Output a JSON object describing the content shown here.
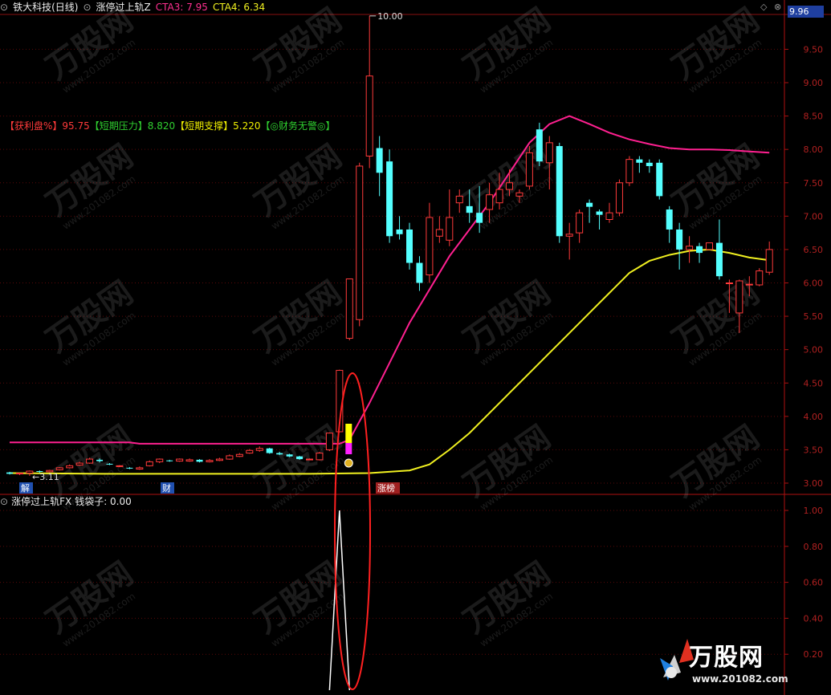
{
  "header": {
    "collapse_icon": "circle-icon",
    "title": "铁大科技(日线)",
    "indicator": "涨停过上轨Z",
    "cta3_label": "CTA3: 7.95",
    "cta4_label": "CTA4: 6.34",
    "current_price": "9.96"
  },
  "info_row": [
    {
      "text": "【获利盘%】",
      "color": "#ff3a3a"
    },
    {
      "text": "95.75",
      "color": "#ff3a3a"
    },
    {
      "text": "【短期压力】",
      "color": "#30d030"
    },
    {
      "text": "8.820",
      "color": "#30d030"
    },
    {
      "text": "【短期支撑】",
      "color": "#f0f000"
    },
    {
      "text": "5.220",
      "color": "#f0f000"
    },
    {
      "text": "【◎财务无警◎】",
      "color": "#30d030"
    }
  ],
  "markers": {
    "min_label": "←3.11",
    "max_label": "10.00",
    "bottom_tags": [
      "解",
      "财",
      "涨榜"
    ]
  },
  "indicator_panel": {
    "title": "涨停过上轨FX",
    "value_label": "钱袋子: 0.00"
  },
  "logo": {
    "text": "万股网",
    "url": "www.201082.com"
  },
  "chart_data": [
    {
      "type": "candlestick",
      "name": "price",
      "ylim": [
        2.95,
        10.15
      ],
      "yticks": [
        "3.00",
        "3.50",
        "4.00",
        "4.50",
        "5.00",
        "5.50",
        "6.00",
        "6.50",
        "7.00",
        "7.50",
        "8.00",
        "8.50",
        "9.00",
        "9.50"
      ],
      "candles": [
        {
          "o": 3.16,
          "c": 3.14,
          "h": 3.17,
          "l": 3.13
        },
        {
          "o": 3.14,
          "c": 3.15,
          "h": 3.16,
          "l": 3.12
        },
        {
          "o": 3.15,
          "c": 3.18,
          "h": 3.19,
          "l": 3.11
        },
        {
          "o": 3.18,
          "c": 3.17,
          "h": 3.19,
          "l": 3.15
        },
        {
          "o": 3.17,
          "c": 3.19,
          "h": 3.2,
          "l": 3.16
        },
        {
          "o": 3.2,
          "c": 3.23,
          "h": 3.24,
          "l": 3.19
        },
        {
          "o": 3.23,
          "c": 3.26,
          "h": 3.28,
          "l": 3.22
        },
        {
          "o": 3.27,
          "c": 3.3,
          "h": 3.32,
          "l": 3.26
        },
        {
          "o": 3.3,
          "c": 3.36,
          "h": 3.38,
          "l": 3.29
        },
        {
          "o": 3.35,
          "c": 3.33,
          "h": 3.37,
          "l": 3.31
        },
        {
          "o": 3.29,
          "c": 3.28,
          "h": 3.3,
          "l": 3.27
        },
        {
          "o": 3.25,
          "c": 3.26,
          "h": 3.27,
          "l": 3.24
        },
        {
          "o": 3.23,
          "c": 3.22,
          "h": 3.24,
          "l": 3.21
        },
        {
          "o": 3.21,
          "c": 3.23,
          "h": 3.25,
          "l": 3.2
        },
        {
          "o": 3.26,
          "c": 3.32,
          "h": 3.34,
          "l": 3.25
        },
        {
          "o": 3.32,
          "c": 3.36,
          "h": 3.37,
          "l": 3.3
        },
        {
          "o": 3.34,
          "c": 3.33,
          "h": 3.35,
          "l": 3.32
        },
        {
          "o": 3.33,
          "c": 3.36,
          "h": 3.37,
          "l": 3.32
        },
        {
          "o": 3.33,
          "c": 3.35,
          "h": 3.37,
          "l": 3.32
        },
        {
          "o": 3.35,
          "c": 3.32,
          "h": 3.36,
          "l": 3.31
        },
        {
          "o": 3.32,
          "c": 3.34,
          "h": 3.36,
          "l": 3.31
        },
        {
          "o": 3.34,
          "c": 3.36,
          "h": 3.38,
          "l": 3.33
        },
        {
          "o": 3.36,
          "c": 3.41,
          "h": 3.43,
          "l": 3.35
        },
        {
          "o": 3.4,
          "c": 3.43,
          "h": 3.45,
          "l": 3.39
        },
        {
          "o": 3.45,
          "c": 3.49,
          "h": 3.51,
          "l": 3.44
        },
        {
          "o": 3.49,
          "c": 3.52,
          "h": 3.55,
          "l": 3.47
        },
        {
          "o": 3.52,
          "c": 3.45,
          "h": 3.53,
          "l": 3.44
        },
        {
          "o": 3.45,
          "c": 3.43,
          "h": 3.47,
          "l": 3.42
        },
        {
          "o": 3.43,
          "c": 3.4,
          "h": 3.44,
          "l": 3.39
        },
        {
          "o": 3.4,
          "c": 3.36,
          "h": 3.41,
          "l": 3.35
        },
        {
          "o": 3.36,
          "c": 3.36,
          "h": 3.37,
          "l": 3.35
        },
        {
          "o": 3.35,
          "c": 3.45,
          "h": 3.47,
          "l": 3.34
        },
        {
          "o": 3.5,
          "c": 3.75,
          "h": 3.76,
          "l": 3.48
        },
        {
          "o": 3.77,
          "c": 4.69,
          "h": 4.7,
          "l": 3.76
        },
        {
          "o": 5.17,
          "c": 6.06,
          "h": 6.06,
          "l": 5.14
        },
        {
          "o": 5.45,
          "c": 7.75,
          "h": 7.8,
          "l": 5.35
        },
        {
          "o": 7.9,
          "c": 9.1,
          "h": 10.0,
          "l": 7.72
        },
        {
          "o": 8.02,
          "c": 7.65,
          "h": 8.2,
          "l": 7.3
        },
        {
          "o": 7.82,
          "c": 6.7,
          "h": 8.0,
          "l": 6.6
        },
        {
          "o": 6.8,
          "c": 6.73,
          "h": 7.0,
          "l": 6.65
        },
        {
          "o": 6.8,
          "c": 6.3,
          "h": 6.9,
          "l": 6.2
        },
        {
          "o": 6.3,
          "c": 6.0,
          "h": 6.4,
          "l": 5.88
        },
        {
          "o": 6.12,
          "c": 6.98,
          "h": 7.2,
          "l": 6.0
        },
        {
          "o": 6.7,
          "c": 6.8,
          "h": 7.0,
          "l": 6.6
        },
        {
          "o": 6.64,
          "c": 6.98,
          "h": 7.4,
          "l": 6.55
        },
        {
          "o": 7.2,
          "c": 7.3,
          "h": 7.4,
          "l": 7.05
        },
        {
          "o": 7.15,
          "c": 7.05,
          "h": 7.4,
          "l": 6.9
        },
        {
          "o": 7.05,
          "c": 6.9,
          "h": 7.45,
          "l": 6.75
        },
        {
          "o": 7.1,
          "c": 7.32,
          "h": 7.5,
          "l": 6.9
        },
        {
          "o": 7.2,
          "c": 7.4,
          "h": 7.65,
          "l": 7.1
        },
        {
          "o": 7.4,
          "c": 7.5,
          "h": 7.7,
          "l": 7.3
        },
        {
          "o": 7.3,
          "c": 7.35,
          "h": 7.4,
          "l": 7.2
        },
        {
          "o": 7.45,
          "c": 7.95,
          "h": 8.05,
          "l": 7.4
        },
        {
          "o": 8.3,
          "c": 7.82,
          "h": 8.4,
          "l": 7.75
        },
        {
          "o": 7.8,
          "c": 8.1,
          "h": 8.2,
          "l": 7.4
        },
        {
          "o": 8.05,
          "c": 6.7,
          "h": 8.1,
          "l": 6.6
        },
        {
          "o": 6.7,
          "c": 6.73,
          "h": 6.9,
          "l": 6.35
        },
        {
          "o": 6.75,
          "c": 7.05,
          "h": 7.1,
          "l": 6.6
        },
        {
          "o": 7.2,
          "c": 7.14,
          "h": 7.25,
          "l": 6.9
        },
        {
          "o": 7.07,
          "c": 7.02,
          "h": 7.1,
          "l": 6.8
        },
        {
          "o": 6.95,
          "c": 7.05,
          "h": 7.2,
          "l": 6.9
        },
        {
          "o": 7.05,
          "c": 7.5,
          "h": 7.55,
          "l": 7.0
        },
        {
          "o": 7.5,
          "c": 7.85,
          "h": 7.9,
          "l": 7.45
        },
        {
          "o": 7.85,
          "c": 7.8,
          "h": 7.9,
          "l": 7.65
        },
        {
          "o": 7.8,
          "c": 7.75,
          "h": 7.85,
          "l": 7.65
        },
        {
          "o": 7.8,
          "c": 7.3,
          "h": 7.85,
          "l": 7.25
        },
        {
          "o": 7.1,
          "c": 6.8,
          "h": 7.15,
          "l": 6.6
        },
        {
          "o": 6.8,
          "c": 6.5,
          "h": 6.9,
          "l": 6.2
        },
        {
          "o": 6.5,
          "c": 6.55,
          "h": 6.7,
          "l": 6.3
        },
        {
          "o": 6.55,
          "c": 6.45,
          "h": 6.6,
          "l": 6.3
        },
        {
          "o": 6.5,
          "c": 6.6,
          "h": 6.6,
          "l": 6.5
        },
        {
          "o": 6.6,
          "c": 6.1,
          "h": 6.95,
          "l": 6.05
        },
        {
          "o": 6.0,
          "c": 6.0,
          "h": 6.05,
          "l": 5.55
        },
        {
          "o": 5.55,
          "c": 6.03,
          "h": 6.05,
          "l": 5.25
        },
        {
          "o": 5.98,
          "c": 5.98,
          "h": 6.1,
          "l": 5.8
        },
        {
          "o": 5.97,
          "c": 6.18,
          "h": 6.22,
          "l": 5.95
        },
        {
          "o": 6.16,
          "c": 6.5,
          "h": 6.62,
          "l": 6.12
        }
      ],
      "series": [
        {
          "name": "CTA3",
          "color": "#ff2090",
          "points": [
            [
              0,
              3.61
            ],
            [
              12,
              3.61
            ],
            [
              13,
              3.59
            ],
            [
              33,
              3.59
            ],
            [
              34,
              3.65
            ],
            [
              36,
              4.2
            ],
            [
              38,
              4.8
            ],
            [
              40,
              5.4
            ],
            [
              42,
              5.9
            ],
            [
              44,
              6.4
            ],
            [
              46,
              6.8
            ],
            [
              48,
              7.2
            ],
            [
              50,
              7.65
            ],
            [
              52,
              8.1
            ],
            [
              54,
              8.38
            ],
            [
              56,
              8.5
            ],
            [
              58,
              8.38
            ],
            [
              60,
              8.25
            ],
            [
              62,
              8.15
            ],
            [
              64,
              8.08
            ],
            [
              66,
              8.02
            ],
            [
              68,
              8.0
            ],
            [
              70,
              8.0
            ],
            [
              72,
              7.99
            ],
            [
              74,
              7.97
            ],
            [
              76,
              7.95
            ]
          ]
        },
        {
          "name": "CTA4",
          "color": "#f0f020",
          "points": [
            [
              0,
              3.15
            ],
            [
              10,
              3.14
            ],
            [
              20,
              3.14
            ],
            [
              30,
              3.14
            ],
            [
              36,
              3.15
            ],
            [
              40,
              3.19
            ],
            [
              42,
              3.28
            ],
            [
              44,
              3.5
            ],
            [
              46,
              3.75
            ],
            [
              48,
              4.05
            ],
            [
              50,
              4.35
            ],
            [
              52,
              4.65
            ],
            [
              54,
              4.95
            ],
            [
              56,
              5.25
            ],
            [
              58,
              5.55
            ],
            [
              60,
              5.85
            ],
            [
              62,
              6.15
            ],
            [
              64,
              6.33
            ],
            [
              66,
              6.42
            ],
            [
              68,
              6.48
            ],
            [
              70,
              6.5
            ],
            [
              72,
              6.45
            ],
            [
              74,
              6.38
            ],
            [
              76,
              6.34
            ]
          ]
        }
      ]
    },
    {
      "type": "line",
      "name": "indicator",
      "ylim": [
        0,
        1.08
      ],
      "yticks": [
        "0.20",
        "0.40",
        "0.60",
        "0.80",
        "1.00"
      ],
      "spike_index": 33,
      "values_note_free": true,
      "points": [
        [
          32,
          0
        ],
        [
          33,
          1.0
        ],
        [
          34,
          0
        ]
      ]
    }
  ]
}
